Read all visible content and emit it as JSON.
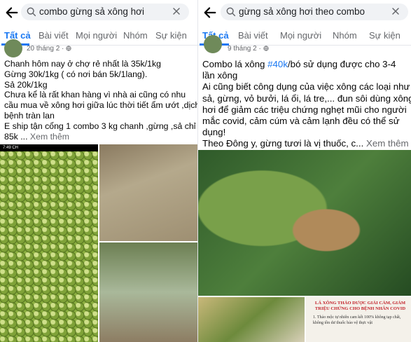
{
  "left": {
    "search": {
      "query": "combo gừng sả xông hơi"
    },
    "tabs": [
      {
        "label": "Tất cả"
      },
      {
        "label": "Bài viết"
      },
      {
        "label": "Mọi người"
      },
      {
        "label": "Nhóm"
      },
      {
        "label": "Sự kiện"
      }
    ],
    "post": {
      "date": "20 tháng 2 · ",
      "lines": [
        "Chanh hôm nay ở chợ rẻ nhất là 35k/1kg",
        "Gừng 30k/1kg ( có nơi bán 5k/1lang).",
        "Sả 20k/1kg",
        "Chưa kể là rất khan hàng vì nhà ai cũng có nhu",
        "cầu mua về xông hơi giữa lúc thời tiết ẩm ướt ,dịch",
        "bệnh tràn lan",
        "E ship tận cổng 1 combo 3 kg chanh ,gừng ,sả chỉ",
        "85k ... "
      ],
      "see_more": "Xem thêm"
    },
    "status_time": "7:49 CH"
  },
  "right": {
    "search": {
      "query": "gừng sả xông hơi theo combo"
    },
    "tabs": [
      {
        "label": "Tất cả"
      },
      {
        "label": "Bài viết"
      },
      {
        "label": "Mọi người"
      },
      {
        "label": "Nhóm"
      },
      {
        "label": "Sự kiện"
      }
    ],
    "post": {
      "date": "9 tháng 2 · ",
      "line1_pre": "Combo lá xông ",
      "line1_hashtag": "#40k",
      "line1_post": "/bó sử dụng được cho 3-4",
      "lines": [
        "lần xông",
        "Ai cũng biết công dụng của việc xông các loại như",
        "sả, gừng, vỏ bưởi, lá ổi, lá tre,... đun sôi dùng xông",
        "hơi để giảm các triệu chứng nghẹt mũi cho người",
        "mắc covid, cảm cúm và cảm lạnh đều có thể sử",
        "dụng!"
      ],
      "last_line": "Theo Đông y, gừng tươi là vị thuốc, c... ",
      "see_more": "Xem thêm"
    },
    "poster": {
      "title": "LÁ XÔNG THẢO DƯỢC GIẢI CẢM, GIẢM TRIỆU CHỨNG CHO BỆNH NHÂN COVID",
      "body": "1. Thảo mộc tự nhiên cam kết 100% không tạp chất, không tồn dư thuốc bảo vệ thực vật"
    }
  }
}
